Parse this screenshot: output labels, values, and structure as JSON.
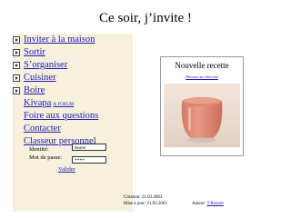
{
  "page_title": "Ce soir, j’invite !",
  "menu": {
    "items": [
      {
        "label": "Inviter à la maison",
        "arrow": true
      },
      {
        "label": "Sortir",
        "arrow": true
      },
      {
        "label": "S’organiser",
        "arrow": true
      },
      {
        "label": "Cuisiner",
        "arrow": true
      },
      {
        "label": "Boire",
        "arrow": true
      },
      {
        "label": "Kivapa",
        "sub": "& FORUM",
        "arrow": false
      },
      {
        "label": "Foire aux questions",
        "arrow": false
      },
      {
        "label": "Contacter",
        "arrow": false
      },
      {
        "label": "Classeur personnel",
        "arrow": false
      }
    ]
  },
  "login": {
    "identity_label": "Identité:",
    "identity_value": "Snow",
    "password_label": "Mot de passe:",
    "password_value": "****",
    "validate_label": "Valider"
  },
  "recipe": {
    "title": "Nouvelle recette",
    "link": "Mousse au chocolat"
  },
  "footer": {
    "created_label": "Création:",
    "created_date": "21.03.2003",
    "updated_label": "Mise à jour:",
    "updated_date": "21.03.2003",
    "author_label": "Auteur:",
    "author_name": "T.Renom"
  },
  "colors": {
    "menu_background": "#f6f0dd",
    "link": "#1c1cae",
    "mousse": "#e08a74"
  }
}
